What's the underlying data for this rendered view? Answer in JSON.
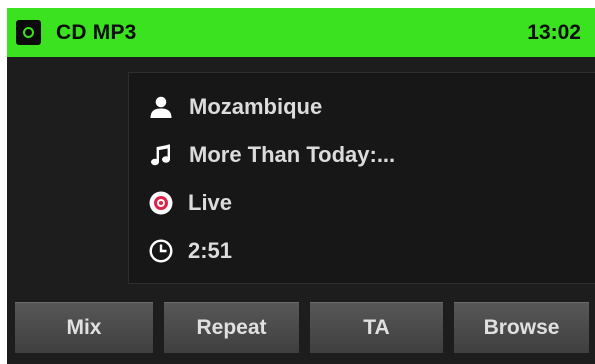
{
  "status_bar": {
    "source_icon": "cd-icon",
    "title": "CD MP3",
    "clock": "13:02"
  },
  "track_info": {
    "artist": {
      "icon": "person-icon",
      "text": "Mozambique"
    },
    "title": {
      "icon": "music-note-icon",
      "text": "More Than Today:..."
    },
    "album": {
      "icon": "disc-icon",
      "text": "Live"
    },
    "time": {
      "icon": "clock-icon",
      "text": "2:51"
    }
  },
  "softkeys": [
    {
      "label": "Mix"
    },
    {
      "label": "Repeat"
    },
    {
      "label": "TA"
    },
    {
      "label": "Browse"
    }
  ],
  "colors": {
    "status_bar": "#3be21f",
    "background": "#1d1d1d",
    "text": "#dcdcdc",
    "disc_accent": "#e0224a"
  }
}
